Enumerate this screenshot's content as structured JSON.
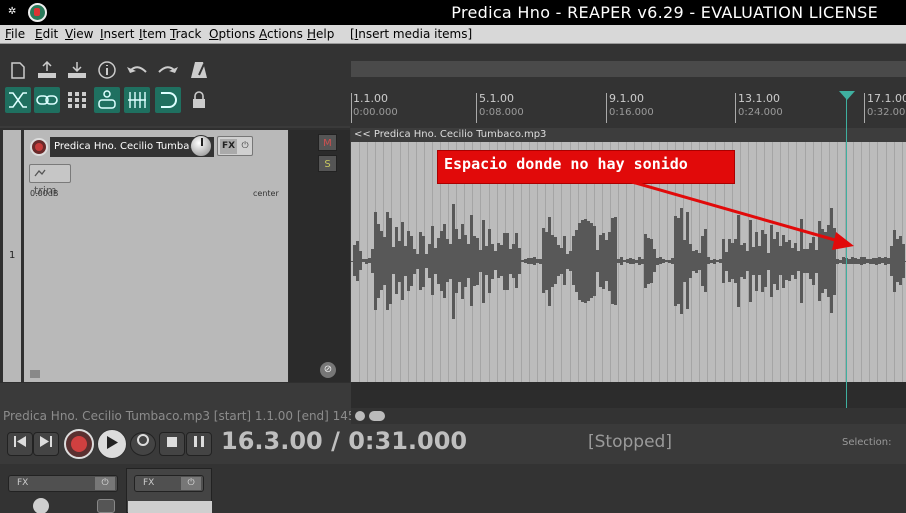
{
  "window": {
    "title": "Predica Hno - REAPER v6.29 - EVALUATION LICENSE",
    "sys_icon": "✲"
  },
  "menubar": {
    "items": [
      "File",
      "Edit",
      "View",
      "Insert",
      "Item",
      "Track",
      "Options",
      "Actions",
      "Help"
    ],
    "action_hint": "[Insert media items]"
  },
  "toolbar": {
    "row1_icons": [
      "new-file-icon",
      "upload-icon",
      "download-icon",
      "info-icon",
      "undo-icon",
      "redo-icon",
      "metronome-icon"
    ],
    "row2_icons": [
      "ripple-edit-icon",
      "link-icon",
      "grid-icon",
      "group-icon",
      "snap-grid-icon",
      "loop-icon",
      "lock-icon"
    ]
  },
  "ruler": {
    "markers": [
      {
        "bar": "1.1.00",
        "time": "0:00.000"
      },
      {
        "bar": "5.1.00",
        "time": "0:08.000"
      },
      {
        "bar": "9.1.00",
        "time": "0:16.000"
      },
      {
        "bar": "13.1.00",
        "time": "0:24.000"
      },
      {
        "bar": "17.1.00",
        "time": "0:32.000"
      }
    ]
  },
  "track": {
    "number": "1",
    "name": "Predica Hno. Cecilio Tumbaco",
    "fx_label": "FX",
    "fx_power": "⏻",
    "trim_label": "trim",
    "volume": "0.00dB",
    "pan": "center",
    "mute": "M",
    "solo": "S",
    "phase": "⊘"
  },
  "media_item": {
    "name": "<< Predica Hno. Cecilio Tumbaco.mp3"
  },
  "annotation": {
    "text": "Espacio donde no hay sonido",
    "color": "#e10a0a"
  },
  "status": {
    "line": "Predica Hno. Cecilio Tumbaco.mp3 [start] 1.1.00 [end] 145"
  },
  "transport": {
    "time": "16.3.00 / 0:31.000",
    "state": "[Stopped]",
    "selection_label": "Selection:",
    "buttons": [
      "skip-start-icon",
      "skip-end-icon",
      "record-icon",
      "play-icon",
      "repeat-icon",
      "stop-icon",
      "pause-icon"
    ]
  },
  "mixer": {
    "fx1": "FX",
    "fx2": "FX",
    "power": "⏻"
  },
  "colors": {
    "accent_teal": "#1f7060",
    "playhead": "#3fb0a0",
    "record_red": "#d04040"
  }
}
